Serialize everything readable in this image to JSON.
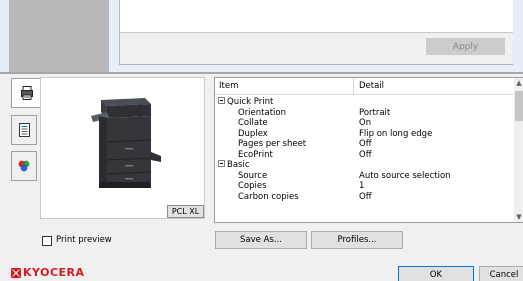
{
  "top": {
    "apply_label": "Apply"
  },
  "tabs": [
    {
      "icon": "printer-settings-icon"
    },
    {
      "icon": "document-icon"
    },
    {
      "icon": "color-icon"
    }
  ],
  "preview": {
    "pcl_label": "PCL XL"
  },
  "table": {
    "headers": {
      "item": "Item",
      "detail": "Detail"
    },
    "rows": [
      {
        "item": "Quick Print",
        "detail": "",
        "type": "group"
      },
      {
        "item": "Orientation",
        "detail": "Portrait",
        "type": "sub"
      },
      {
        "item": "Collate",
        "detail": "On",
        "type": "sub"
      },
      {
        "item": "Duplex",
        "detail": "Flip on long edge",
        "type": "sub"
      },
      {
        "item": "Pages per sheet",
        "detail": "Off",
        "type": "sub"
      },
      {
        "item": "EcoPrint",
        "detail": "Off",
        "type": "sub"
      },
      {
        "item": "Basic",
        "detail": "",
        "type": "group"
      },
      {
        "item": "Source",
        "detail": "Auto source selection",
        "type": "sub"
      },
      {
        "item": "Copies",
        "detail": "1",
        "type": "sub"
      },
      {
        "item": "Carbon copies",
        "detail": "Off",
        "type": "sub"
      }
    ]
  },
  "bottom": {
    "print_preview": "Print preview",
    "save_as": "Save As...",
    "profiles": "Profiles...",
    "ok": "OK",
    "cancel": "Cancel"
  },
  "brand": {
    "logo_text": "KYOCERA",
    "color": "#d71920"
  }
}
